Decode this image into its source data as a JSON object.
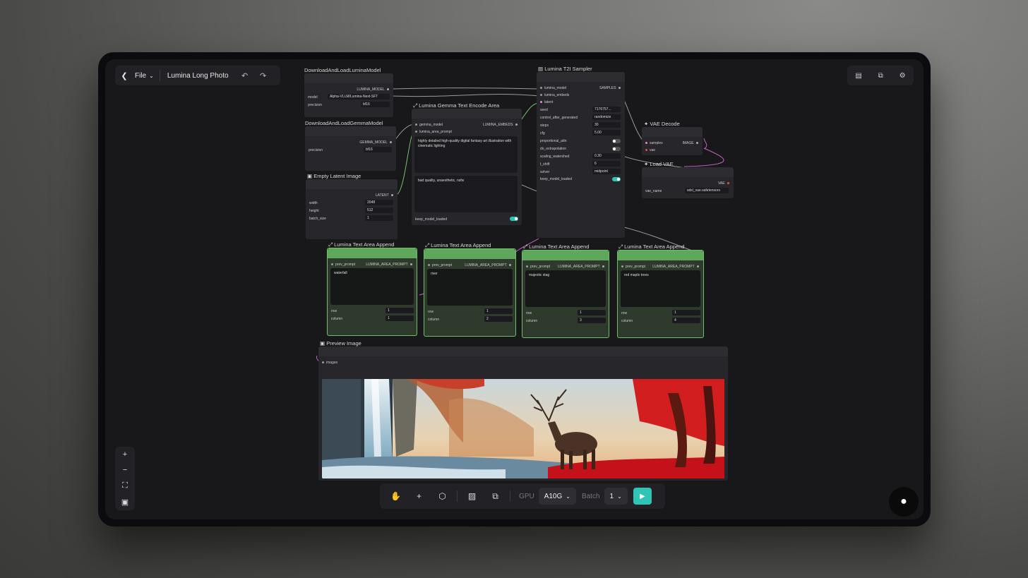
{
  "topbar": {
    "back_icon": "chevron-left-icon",
    "file_label": "File",
    "title": "Lumina Long Photo",
    "undo_icon": "undo-icon",
    "redo_icon": "redo-icon"
  },
  "topright": {
    "icons": [
      "panel-icon",
      "queue-icon",
      "gear-icon"
    ]
  },
  "nodes": {
    "download_lumina": {
      "title": "DownloadAndLoadLuminaModel",
      "output": "LUMINA_MODEL",
      "model_label": "model",
      "model_value": "Alpha-VLLM/Lumina-Next-SFT",
      "precision_label": "precision",
      "precision_value": "bf16"
    },
    "download_gemma": {
      "title": "DownloadAndLoadGemmaModel",
      "output": "GEMMA_MODEL",
      "precision_label": "precision",
      "precision_value": "bf16"
    },
    "empty_latent": {
      "title": "Empty Latent Image",
      "output": "LATENT",
      "width_label": "width",
      "width_value": "2048",
      "height_label": "height",
      "height_value": "512",
      "batch_label": "batch_size",
      "batch_value": "1"
    },
    "gemma_encode": {
      "title": "Lumina Gemma Text Encode Area",
      "input1": "gemma_model",
      "input2": "lumina_area_prompt",
      "output": "LUMINA_EMBEDS",
      "prompt": "highly detailed high-quality digital fantasy art illustration with cinematic lighting",
      "negative": "bad quality, unaesthetic, nsfw",
      "keep_label": "keep_model_loaded"
    },
    "sampler": {
      "title": "Lumina T2I Sampler",
      "inputs": [
        "lumina_model",
        "lumina_embeds",
        "latent"
      ],
      "output": "SAMPLES",
      "seed_label": "seed",
      "seed_value": "7176757...",
      "control_label": "control_after_generated",
      "control_value": "randomize",
      "steps_label": "steps",
      "steps_value": "30",
      "cfg_label": "cfg",
      "cfg_value": "5.00",
      "prop_label": "proportional_attn",
      "dc_label": "do_extrapolation",
      "scaling_label": "scaling_watershed",
      "scaling_value": "0.30",
      "tshift_label": "t_shift",
      "tshift_value": "6",
      "solver_label": "solver",
      "solver_value": "midpoint",
      "keep_label": "keep_model_loaded"
    },
    "vae_decode": {
      "title": "VAE Decode",
      "in1": "samples",
      "in2": "vae",
      "output": "IMAGE"
    },
    "load_vae": {
      "title": "Load VAE",
      "output": "VAE",
      "name_label": "vae_name",
      "name_value": "sdxl_vae.safetensors"
    },
    "append": [
      {
        "title": "Lumina Text Area Append",
        "input": "prev_prompt",
        "output": "LUMINA_AREA_PROMPT",
        "text": "waterfall",
        "row_label": "row",
        "row": "1",
        "col_label": "column",
        "col": "1"
      },
      {
        "title": "Lumina Text Area Append",
        "input": "prev_prompt",
        "output": "LUMINA_AREA_PROMPT",
        "text": "river",
        "row_label": "row",
        "row": "1",
        "col_label": "column",
        "col": "2"
      },
      {
        "title": "Lumina Text Area Append",
        "input": "prev_prompt",
        "output": "LUMINA_AREA_PROMPT",
        "text": "majestic stag",
        "row_label": "row",
        "row": "1",
        "col_label": "column",
        "col": "3"
      },
      {
        "title": "Lumina Text Area Append",
        "input": "prev_prompt",
        "output": "LUMINA_AREA_PROMPT",
        "text": "red maple trees",
        "row_label": "row",
        "row": "1",
        "col_label": "column",
        "col": "4"
      }
    ],
    "preview": {
      "title": "Preview Image",
      "input": "images"
    }
  },
  "zoom": {
    "icons": [
      "plus-icon",
      "minus-icon",
      "fit-icon",
      "lock-icon"
    ]
  },
  "bottombar": {
    "gpu_label": "GPU",
    "gpu_value": "A10G",
    "batch_label": "Batch",
    "batch_value": "1"
  },
  "colors": {
    "accent": "#2ec4b6",
    "group_green": "#5fa75a",
    "canvas": "#18181b"
  }
}
